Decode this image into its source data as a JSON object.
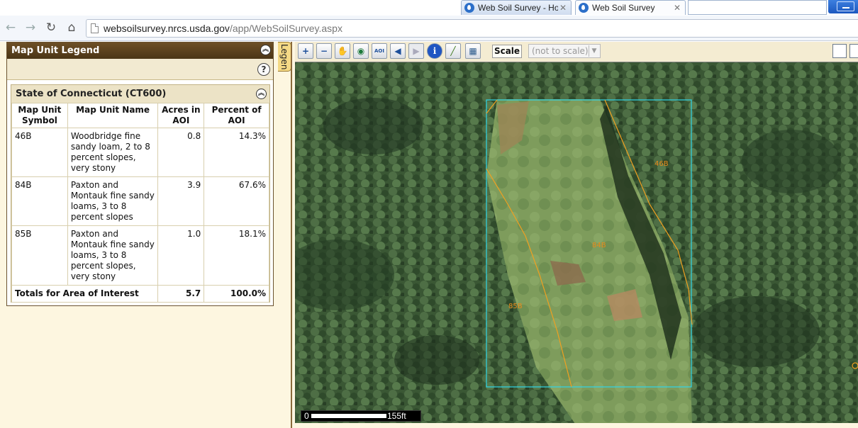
{
  "browser": {
    "tabs": [
      {
        "label": "Web Soil Survey - Home",
        "close": "✕"
      },
      {
        "label": "Web Soil Survey",
        "close": "✕"
      }
    ],
    "nav": {
      "back": "←",
      "forward": "→",
      "reload": "↻",
      "home": "⌂"
    },
    "url_host": "websoilsurvey.nrcs.usda.gov",
    "url_path": "/app/WebSoilSurvey.aspx"
  },
  "legend": {
    "title": "Map Unit Legend",
    "collapse_icon": "︽",
    "help_icon": "?",
    "tab_label": "Legend",
    "state_title": "State of Connecticut (CT600)",
    "columns": [
      "Map Unit Symbol",
      "Map Unit Name",
      "Acres in AOI",
      "Percent of AOI"
    ],
    "rows": [
      {
        "symbol": "46B",
        "name": "Woodbridge fine sandy loam, 2 to 8 percent slopes, very stony",
        "acres": "0.8",
        "percent": "14.3%"
      },
      {
        "symbol": "84B",
        "name": "Paxton and Montauk fine sandy loams, 3 to 8 percent slopes",
        "acres": "3.9",
        "percent": "67.6%"
      },
      {
        "symbol": "85B",
        "name": "Paxton and Montauk fine sandy loams, 3 to 8 percent slopes, very stony",
        "acres": "1.0",
        "percent": "18.1%"
      }
    ],
    "totals": {
      "label": "Totals for Area of Interest",
      "acres": "5.7",
      "percent": "100.0%"
    }
  },
  "toolbar": {
    "tools": [
      {
        "name": "zoom-in-tool",
        "glyph": "+"
      },
      {
        "name": "zoom-out-tool",
        "glyph": "−"
      },
      {
        "name": "pan-tool",
        "glyph": "✋"
      },
      {
        "name": "full-extent-tool",
        "glyph": "◉"
      },
      {
        "name": "aoi-tool",
        "glyph": "AOI"
      },
      {
        "name": "back-extent-tool",
        "glyph": "◀"
      },
      {
        "name": "forward-extent-tool",
        "glyph": "▶"
      },
      {
        "name": "identify-tool",
        "glyph": "i"
      },
      {
        "name": "measure-tool",
        "glyph": "╱"
      },
      {
        "name": "layers-tool",
        "glyph": "▦"
      }
    ],
    "scale_label": "Scale",
    "scale_value": "(not to scale)",
    "scale_arrow": "▼"
  },
  "map": {
    "labels": [
      "46B",
      "84B",
      "85B"
    ],
    "scalebar": {
      "zero": "0",
      "distance": "155ft"
    },
    "colors": {
      "aoi_boundary": "#2fd6e8",
      "soil_line": "#f0a020",
      "soil_label": "#e98a1a"
    }
  }
}
